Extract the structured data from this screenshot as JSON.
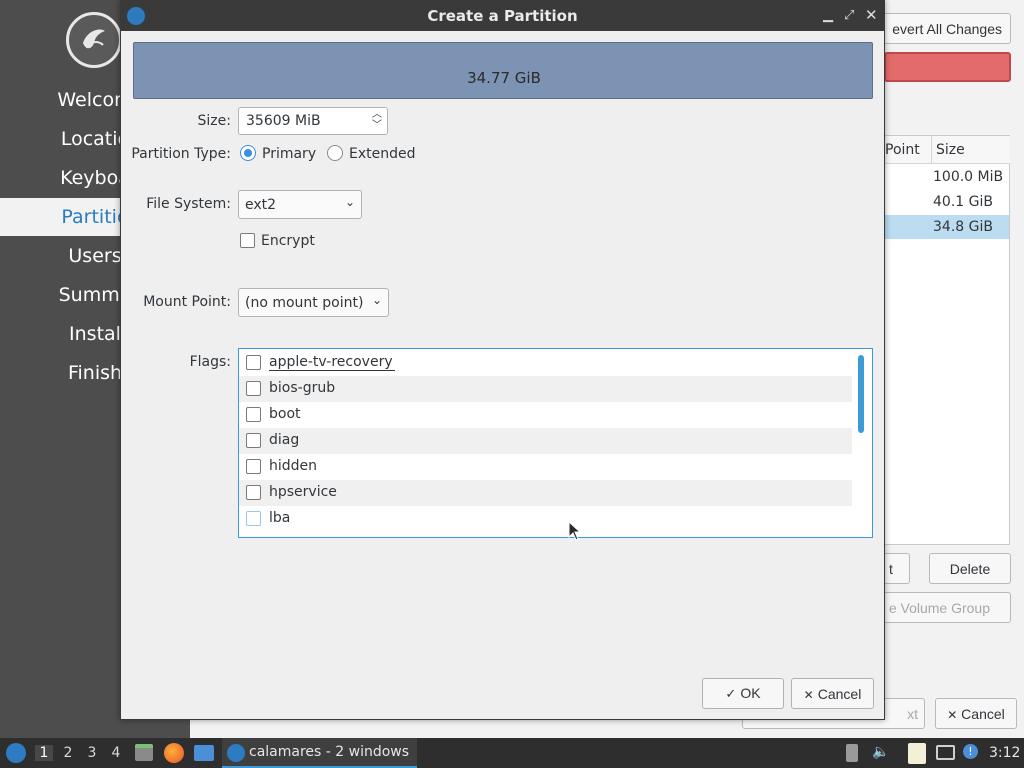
{
  "background": {
    "sidebar": {
      "items": [
        "Welcom",
        "Locatio",
        "Keyboa",
        "Partitio",
        "Users",
        "Summa",
        "Instal",
        "Finish"
      ],
      "active_index": 3
    },
    "revert_button": "evert All Changes",
    "table": {
      "columns": [
        "Point",
        "Size"
      ],
      "sizes": [
        "100.0 MiB",
        "40.1 GiB",
        "34.8 GiB"
      ]
    },
    "edit_button_fragment": "t",
    "delete_button": "Delete",
    "volume_group_button": "e Volume Group",
    "next_button_fragment": "xt",
    "cancel_button": "Cancel"
  },
  "dialog": {
    "title": "Create a Partition",
    "partition_bar_label": "34.77 GiB",
    "size_label": "Size:",
    "size_value": "35609 MiB",
    "partition_type_label": "Partition Type:",
    "type_primary": "Primary",
    "type_extended": "Extended",
    "file_system_label": "File System:",
    "file_system_value": "ext2",
    "encrypt_label": "Encrypt",
    "mount_point_label": "Mount Point:",
    "mount_point_value": "(no mount point)",
    "flags_label": "Flags:",
    "flags": [
      "apple-tv-recovery",
      "bios-grub",
      "boot",
      "diag",
      "hidden",
      "hpservice",
      "lba"
    ],
    "ok_button": "OK",
    "cancel_button": "Cancel"
  },
  "taskbar": {
    "workspaces": [
      "1",
      "2",
      "3",
      "4"
    ],
    "active_workspace": "1",
    "task_label": "calamares - 2 windows",
    "clock": "3:12"
  },
  "colors": {
    "accent": "#3d9ad6",
    "partition_bar": "#7c93b3",
    "sidebar_bg": "#4d4d4d",
    "revert_red": "#e46b6b"
  }
}
